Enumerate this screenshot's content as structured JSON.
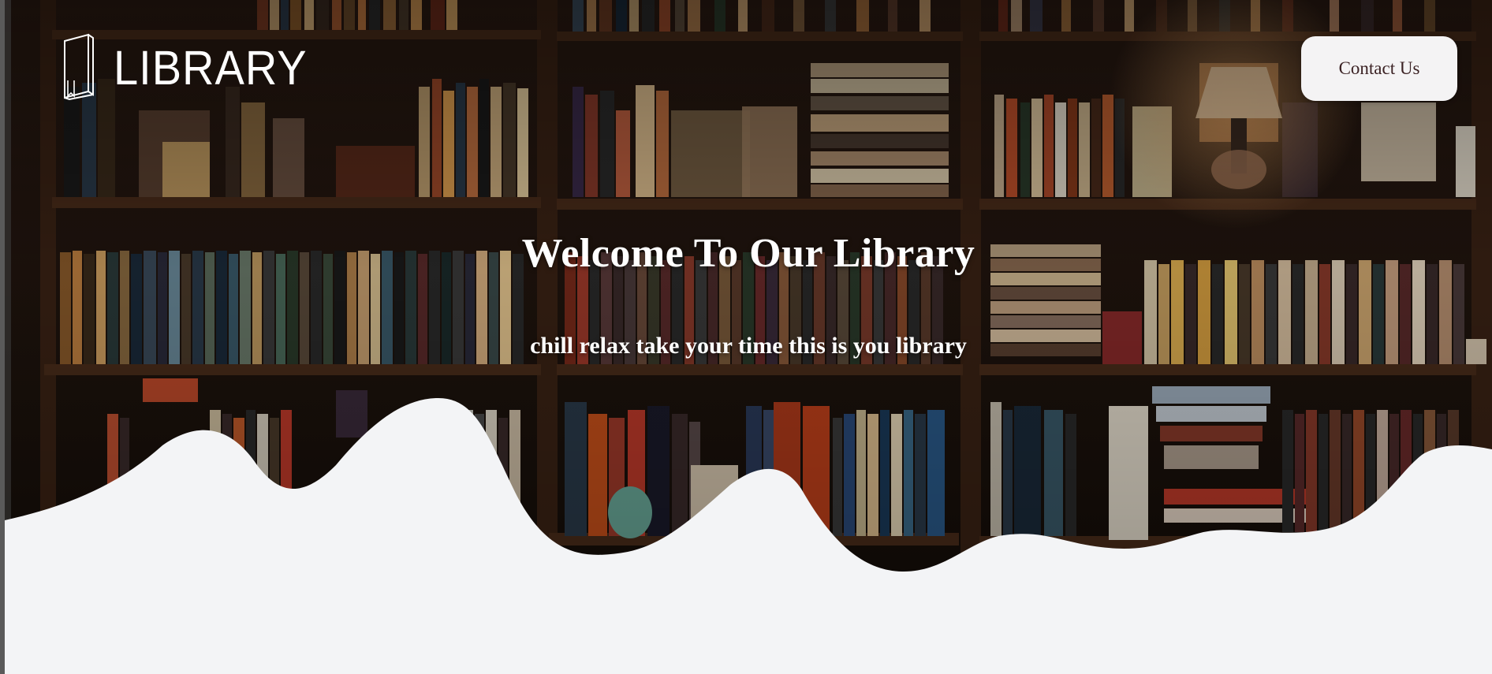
{
  "header": {
    "logo_text": "LIBRARY",
    "contact_label": "Contact Us"
  },
  "hero": {
    "title": "Welcome To Our Library",
    "subtitle": "chill relax take your time this is you library"
  },
  "colors": {
    "page_background": "#f3f4f6",
    "button_background": "#f4f3f4",
    "button_text": "#3b2224",
    "hero_text": "#ffffff"
  },
  "icons": [
    "book-logo-icon"
  ]
}
